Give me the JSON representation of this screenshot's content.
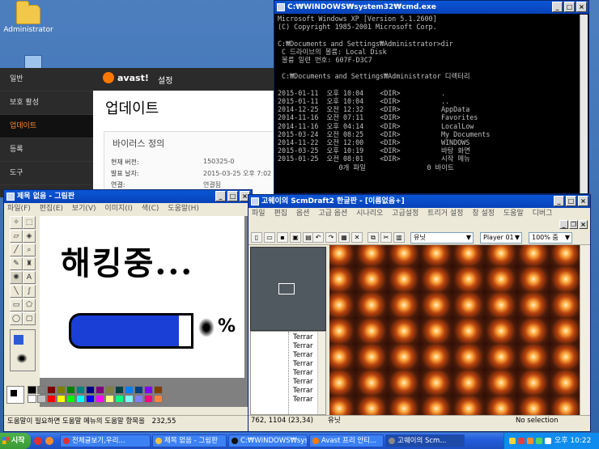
{
  "desktop": {
    "icon_label": "Administrator"
  },
  "avast": {
    "brand": "avast!",
    "settings": "설정",
    "menu": [
      "일반",
      "보호 활성",
      "업데이트",
      "등록",
      "도구"
    ],
    "title": "업데이트",
    "section": "바이러스 정의",
    "rows": [
      {
        "label": "현재 버전:",
        "value": "150325-0"
      },
      {
        "label": "발표 날자:",
        "value": "2015-03-25 오후 7:02"
      },
      {
        "label": "연결:",
        "value": "연결됨"
      }
    ]
  },
  "cmd": {
    "title": "C:₩WINDOWS₩system32₩cmd.exe",
    "lines": [
      "Microsoft Windows XP [Version 5.1.2600]",
      "(C) Copyright 1985-2001 Microsoft Corp.",
      "",
      "C:₩Documents and Settings₩Administrator>dir",
      " C 드라이브의 볼륨: Local Disk",
      " 볼륨 일련 번호: 607F-D3C7",
      "",
      " C:₩Documents and Settings₩Administrator 디렉터리",
      "",
      "2015-01-11  오후 10:04    <DIR>          .",
      "2015-01-11  오후 10:04    <DIR>          ..",
      "2014-12-25  오전 12:32    <DIR>          AppData",
      "2014-11-16  오전 07:11    <DIR>          Favorites",
      "2014-11-16  오후 04:14    <DIR>          LocalLow",
      "2015-03-24  오전 08:25    <DIR>          My Documents",
      "2014-11-22  오전 12:00    <DIR>          WINDOWS",
      "2015-03-25  오후 10:19    <DIR>          바탕 화면",
      "2015-01-25  오전 08:01    <DIR>          시작 메뉴",
      "               0개 파일               0 바이트"
    ]
  },
  "paint": {
    "title": "제목 없음 - 그림판",
    "menu": [
      "파일(F)",
      "편집(E)",
      "보기(V)",
      "이미지(I)",
      "색(C)",
      "도움말(H)"
    ],
    "canvas_text": "해킹중...",
    "canvas_percent": "%",
    "status_help": "도움말이 필요하면 도움말 메뉴의 도움말 항목을",
    "status_coords": "232,55",
    "palette": [
      "#000000",
      "#808080",
      "#800000",
      "#808000",
      "#008000",
      "#008080",
      "#000080",
      "#800080",
      "#808040",
      "#004040",
      "#0080ff",
      "#004080",
      "#8000ff",
      "#804000",
      "#ffffff",
      "#c0c0c0",
      "#ff0000",
      "#ffff00",
      "#00ff00",
      "#00ffff",
      "#0000ff",
      "#ff00ff",
      "#ffff80",
      "#00ff80",
      "#80ffff",
      "#8080ff",
      "#ff0080",
      "#ff8040"
    ]
  },
  "scm": {
    "title": "고웨이의 ScmDraft2 한글판 - [이름없음+]",
    "menu": [
      "파일",
      "편집",
      "옵션",
      "고급 옵션",
      "시나리오",
      "고급설정",
      "트리거 설정",
      "창 설정",
      "도움말",
      "디버그"
    ],
    "layer": "유닛",
    "player": "Player 01",
    "zoom": "100% 줌",
    "terrain_items": [
      "Terrar",
      "Terrar",
      "Terrar",
      "Terrar",
      "Terrar",
      "Terrar",
      "Terrar",
      "Terrar"
    ],
    "status_coords": "762, 1104 (23,34)",
    "status_layer": "유닛",
    "status_sel": "No selection"
  },
  "taskbar": {
    "start": "시작",
    "tasks": [
      "전체글보기,우리...",
      "제목 없음 - 그림판",
      "C:₩WINDOWS₩sys...",
      "Avast 프리 안티...",
      "고웨이의 Scm..."
    ],
    "clock": "오후 10:22"
  }
}
